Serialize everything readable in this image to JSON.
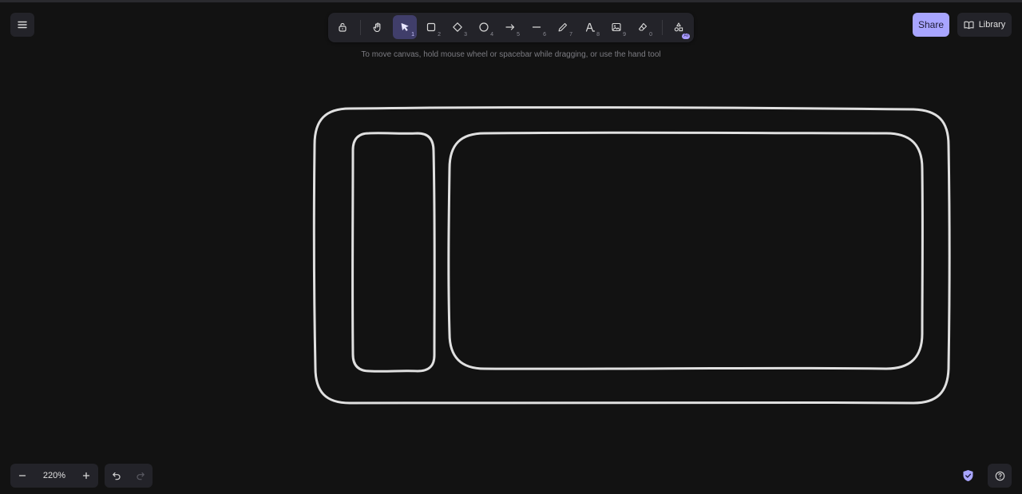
{
  "colors": {
    "background": "#121212",
    "panel": "#232329",
    "accent": "#a8a5ff",
    "active_tool": "#403e6a",
    "stroke": "#e0e0e0"
  },
  "menu": {
    "icon": "hamburger-icon"
  },
  "toolbar": {
    "tools": [
      {
        "name": "lock",
        "icon": "lock-icon",
        "key": ""
      },
      {
        "name": "hand",
        "icon": "hand-icon",
        "key": ""
      },
      {
        "name": "selection",
        "icon": "pointer-icon",
        "key": "1",
        "active": true
      },
      {
        "name": "rectangle",
        "icon": "square-icon",
        "key": "2"
      },
      {
        "name": "diamond",
        "icon": "diamond-icon",
        "key": "3"
      },
      {
        "name": "ellipse",
        "icon": "circle-icon",
        "key": "4"
      },
      {
        "name": "arrow",
        "icon": "arrow-right-icon",
        "key": "5"
      },
      {
        "name": "line",
        "icon": "line-icon",
        "key": "6"
      },
      {
        "name": "draw",
        "icon": "pencil-icon",
        "key": "7"
      },
      {
        "name": "text",
        "icon": "text-icon",
        "key": "8"
      },
      {
        "name": "image",
        "icon": "image-icon",
        "key": "9"
      },
      {
        "name": "eraser",
        "icon": "eraser-icon",
        "key": "0"
      },
      {
        "name": "more-shapes",
        "icon": "shapes-icon",
        "badge": "AI"
      }
    ]
  },
  "hint": "To move canvas, hold mouse wheel or spacebar while dragging, or use the hand tool",
  "share_label": "Share",
  "library_label": "Library",
  "zoom": {
    "value": "220%"
  }
}
